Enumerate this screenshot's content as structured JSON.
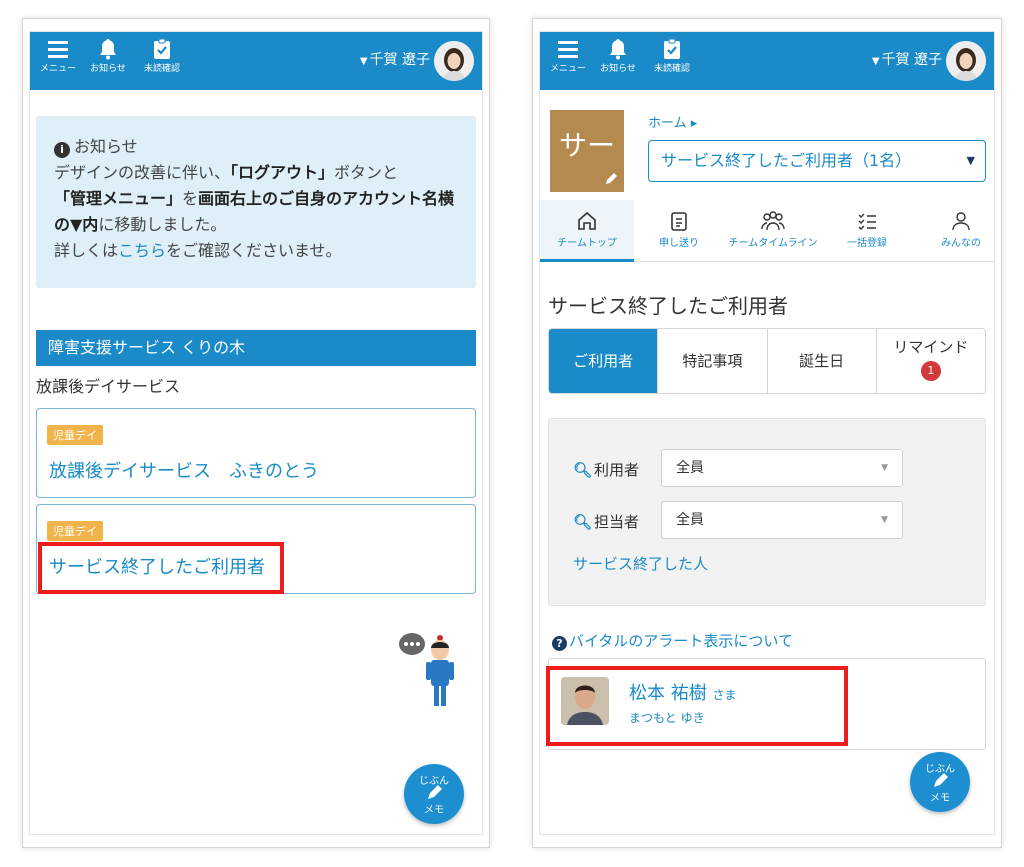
{
  "header": {
    "menu_label": "メニュー",
    "notice_label": "お知らせ",
    "unread_label": "未読確認",
    "user_name": "千賀 遼子"
  },
  "left": {
    "notice": {
      "title": "お知らせ",
      "line1": "デザインの改善に伴い、",
      "logout": "「ログアウト」",
      "line1b": "ボタンと",
      "admin": "「管理メニュー」",
      "line2a": "を",
      "line2b": "画面右上のご自身のアカウント名横の▼内",
      "line2c": "に移動しました。",
      "line3a": "詳しくは",
      "link": "こちら",
      "line3b": "をご確認くださいませ。"
    },
    "facility": "障害支援サービス くりの木",
    "service_type": "放課後デイサービス",
    "cards": [
      {
        "badge": "児童デイ",
        "title": "放課後デイサービス　ふきのとう"
      },
      {
        "badge": "児童デイ",
        "title": "サービス終了したご利用者"
      }
    ]
  },
  "memo": {
    "top": "じぶん",
    "bottom": "メモ"
  },
  "right": {
    "team_icon_text": "サー",
    "breadcrumb": "ホーム ▸",
    "team_select": "サービス終了したご利用者（1名）",
    "tabs": [
      "チームトップ",
      "申し送り",
      "チームタイムライン",
      "一括登録",
      "みんなの"
    ],
    "page_title": "サービス終了したご利用者",
    "segments": [
      "ご利用者",
      "特記事項",
      "誕生日",
      "リマインド"
    ],
    "remind_count": "1",
    "filter": {
      "user_label": "利用者",
      "user_value": "全員",
      "staff_label": "担当者",
      "staff_value": "全員",
      "ended_link": "サービス終了した人"
    },
    "vital_link": "バイタルのアラート表示について",
    "person": {
      "name": "松本 祐樹",
      "honorific": "さま",
      "kana": "まつもと ゆき"
    }
  },
  "colors": {
    "primary": "#1a8ac8",
    "badge": "#f0b44a",
    "highlight": "#ee1c1c",
    "team_icon": "#b48a4e"
  }
}
